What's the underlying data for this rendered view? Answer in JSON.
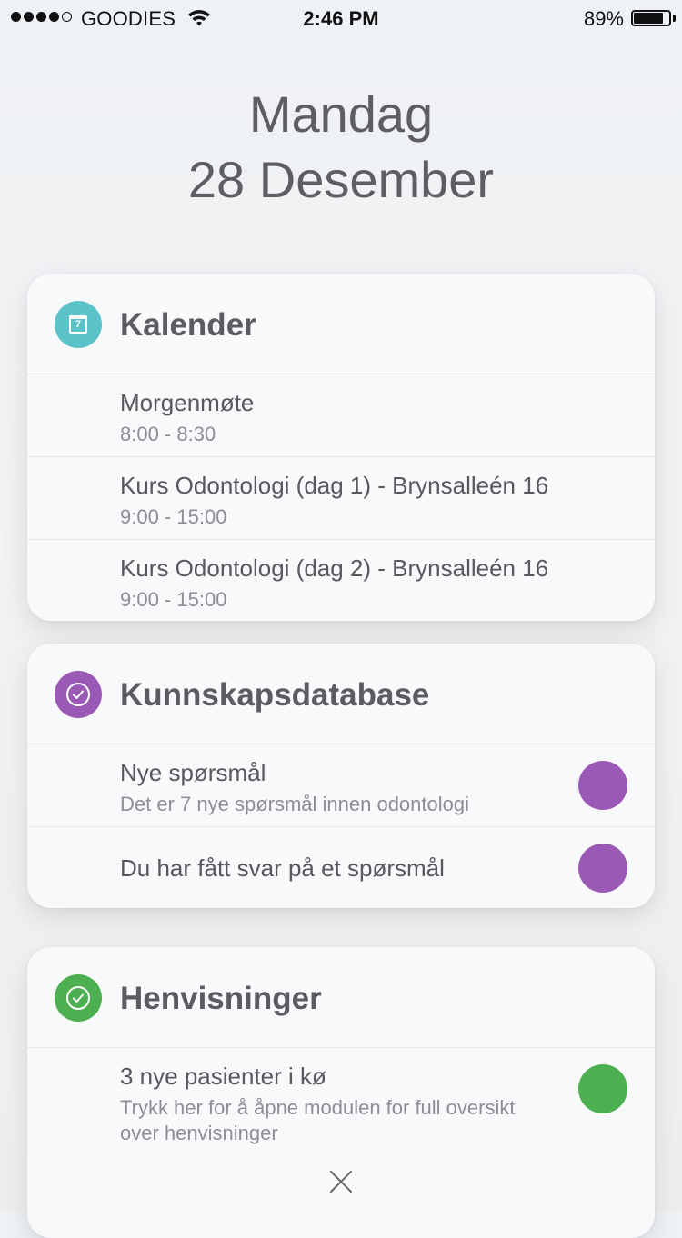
{
  "status_bar": {
    "carrier": "GOODIES",
    "time": "2:46 PM",
    "battery_percent": "89%",
    "battery_level": 0.89,
    "signal_bars_filled": 4,
    "signal_bars_total": 5
  },
  "date": {
    "weekday": "Mandag",
    "day_month": "28 Desember"
  },
  "calendar": {
    "title": "Kalender",
    "icon": "calendar-icon",
    "icon_day": "7",
    "accent": "#5bc2c9",
    "events": [
      {
        "title": "Morgenmøte",
        "time": "8:00 - 8:30"
      },
      {
        "title": "Kurs Odontologi (dag 1) - Brynsalleén 16",
        "time": "9:00 - 15:00"
      },
      {
        "title": "Kurs Odontologi (dag 2) - Brynsalleén 16",
        "time": "9:00  - 15:00"
      }
    ]
  },
  "knowledge": {
    "title": "Kunnskapsdatabase",
    "icon": "checkmark-icon",
    "accent": "#9b59b6",
    "items": [
      {
        "title": "Nye spørsmål",
        "subtitle": "Det er 7 nye spørsmål innen odontologi"
      },
      {
        "title": "Du har fått svar på et spørsmål",
        "subtitle": ""
      }
    ]
  },
  "referrals": {
    "title": "Henvisninger",
    "icon": "checkmark-icon",
    "accent": "#4caf50",
    "items": [
      {
        "title": "3 nye pasienter i kø",
        "subtitle_line1": "Trykk her for å åpne modulen for full oversikt",
        "subtitle_line2": "over henvisninger"
      }
    ],
    "close_icon": "close-icon"
  }
}
